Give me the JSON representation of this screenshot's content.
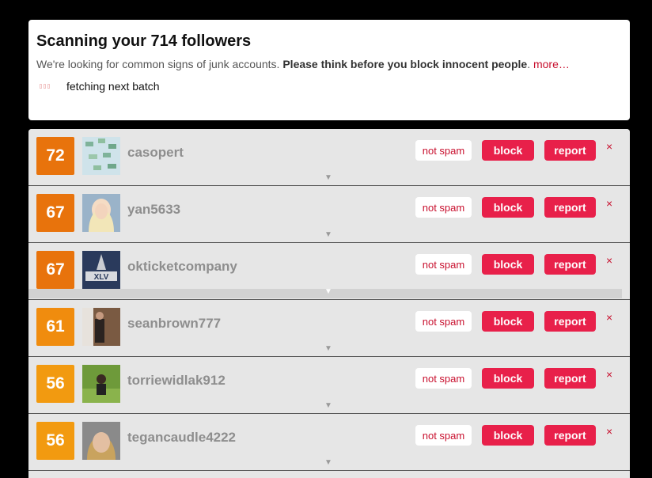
{
  "header": {
    "title": "Scanning your 714 followers",
    "subtitle_plain": "We're looking for common signs of junk accounts. ",
    "subtitle_bold": "Please think before you block innocent people",
    "subtitle_end": ". ",
    "more_link": "more…",
    "status": "fetching next batch"
  },
  "actions": {
    "not_spam": "not spam",
    "block": "block",
    "report": "report",
    "close": "×",
    "expand": "▼"
  },
  "rows": [
    {
      "score": "72",
      "username": "casopert",
      "score_color": "#e8730c"
    },
    {
      "score": "67",
      "username": "yan5633",
      "score_color": "#e8730c"
    },
    {
      "score": "67",
      "username": "okticketcompany",
      "score_color": "#e8730c"
    },
    {
      "score": "61",
      "username": "seanbrown777",
      "score_color": "#f08c0e"
    },
    {
      "score": "56",
      "username": "torriewidlak912",
      "score_color": "#f29a10"
    },
    {
      "score": "56",
      "username": "tegancaudle4222",
      "score_color": "#f29a10"
    }
  ]
}
